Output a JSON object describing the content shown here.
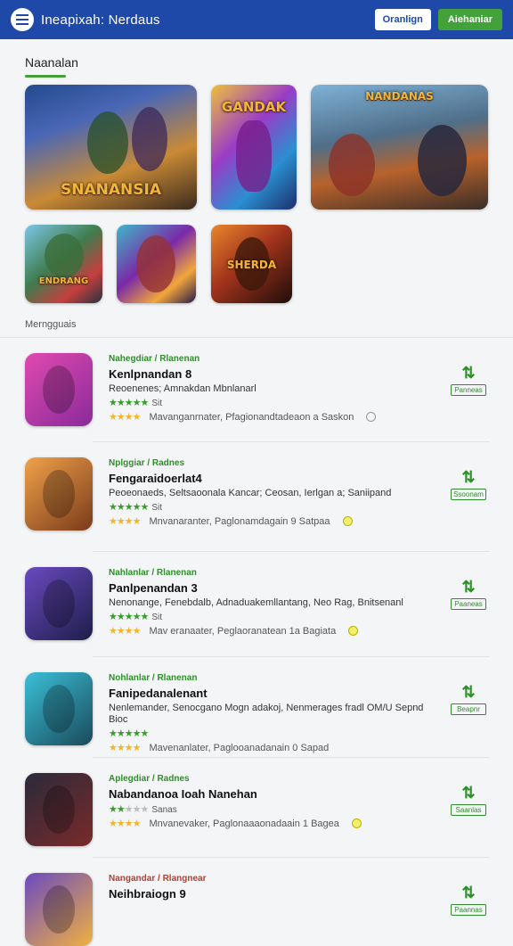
{
  "header": {
    "title": "Ineapixah: Nerdaus",
    "btn_secondary": "Oranlign",
    "btn_primary": "Aiehaniar"
  },
  "featured": {
    "heading": "Naanalan",
    "tiles": [
      {
        "caption": "SNANANSIA"
      },
      {
        "caption": "GANDAK"
      },
      {
        "caption": "NANDANAS"
      },
      {
        "caption": "ENDRANG"
      },
      {
        "caption": ""
      },
      {
        "caption": "SHERDA"
      }
    ]
  },
  "list_heading": "Merngguais",
  "colors": {
    "header": "#1e49a8",
    "accent": "#43a13a"
  },
  "items": [
    {
      "category": "Nahegdiar / Rlanenan",
      "title": "Kenlpnandan 8",
      "desc": "Reoenenes; Amnakdan Mbnlanarl",
      "rating": "Sit",
      "foot": "Mavanganrnater, Pfagionandtadeaon a Saskon",
      "download": "Panneas",
      "cat_color": "green",
      "foot_dot": "gray"
    },
    {
      "category": "Nplggiar / Radnes",
      "title": "Fengaraidoerlat4",
      "desc": "Peoeonaeds, Seltsaoonala Kancar; Ceosan, Ierlgan a; Saniipand",
      "rating": "Sit",
      "foot": "Mnvanaranter, Paglonamdagain 9 Satpaa",
      "download": "Ssoonam",
      "cat_color": "green",
      "foot_dot": "y"
    },
    {
      "category": "Nahlanlar / Rlanenan",
      "title": "Panlpenandan 3",
      "desc": "Nenonange, Fenebdalb, Adnaduakemllantang, Neo Rag, Bnitsenanl",
      "rating": "Sit",
      "foot": "Mav eranaater, Peglaoranatean 1a Bagiata",
      "download": "Paaneas",
      "cat_color": "green",
      "foot_dot": "y"
    },
    {
      "category": "Nohlanlar / Rlanenan",
      "title": "Fanipedanalenant",
      "desc": "Nenlemander, Senocgano Mogn adakoj, Nenmerages fradl OM/U Sepnd Bioc",
      "rating": "",
      "foot": "Mavenanlater, Paglooanadanain 0 Sapad",
      "download": "Beapnr",
      "cat_color": "green",
      "foot_dot": "none"
    },
    {
      "category": "Aplegdiar / Radnes",
      "title": "Nabandanoa Ioah Nanehan",
      "desc": "",
      "rating": "Sanas",
      "foot": "Mnvanevaker, Paglonaaaonadaain 1 Bagea",
      "download": "Saanlas",
      "cat_color": "green",
      "foot_dot": "y"
    },
    {
      "category": "Nangandar / Rlangnear",
      "title": "Neihbraiogn 9",
      "desc": "",
      "rating": "",
      "foot": "",
      "download": "Paannas",
      "cat_color": "red",
      "foot_dot": "none"
    }
  ]
}
